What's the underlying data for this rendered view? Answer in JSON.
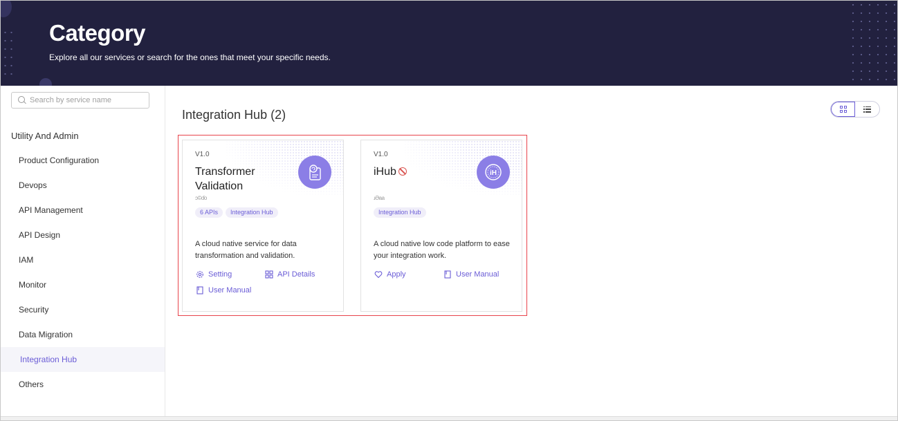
{
  "header": {
    "title": "Category",
    "subtitle": "Explore all our services or search for the ones that meet your specific needs."
  },
  "sidebar": {
    "search": {
      "placeholder": "Search by service name",
      "value": ""
    },
    "group_title": "Utility And Admin",
    "items": [
      {
        "label": "Product Configuration"
      },
      {
        "label": "Devops"
      },
      {
        "label": "API Management"
      },
      {
        "label": "API Design"
      },
      {
        "label": "IAM"
      },
      {
        "label": "Monitor"
      },
      {
        "label": "Security"
      },
      {
        "label": "Data Migration"
      },
      {
        "label": "Integration Hub",
        "active": true
      },
      {
        "label": "Others"
      }
    ]
  },
  "main": {
    "title": "Integration Hub (2)",
    "view_mode": "grid"
  },
  "cards": [
    {
      "version": "V1.0",
      "title": "Transformer Validation",
      "meta": "ɔ©ɗo",
      "tags": [
        "6 APIs",
        "Integration Hub"
      ],
      "description": "A cloud native service for data transformation and validation.",
      "actions": {
        "setting": "Setting",
        "api_details": "API Details",
        "user_manual": "User Manual"
      }
    },
    {
      "version": "V1.0",
      "title": "iHub",
      "status_icon": "ban-icon",
      "logo_text": "iH",
      "meta": "ɹƏaa",
      "tags": [
        "Integration Hub"
      ],
      "description": "A cloud native low code platform to ease your integration work.",
      "actions": {
        "apply": "Apply",
        "user_manual": "User Manual"
      }
    }
  ],
  "colors": {
    "header_bg": "#22213f",
    "accent": "#6a5cd6",
    "logo_bg": "#8b7ee6",
    "highlight": "#e8434b"
  }
}
